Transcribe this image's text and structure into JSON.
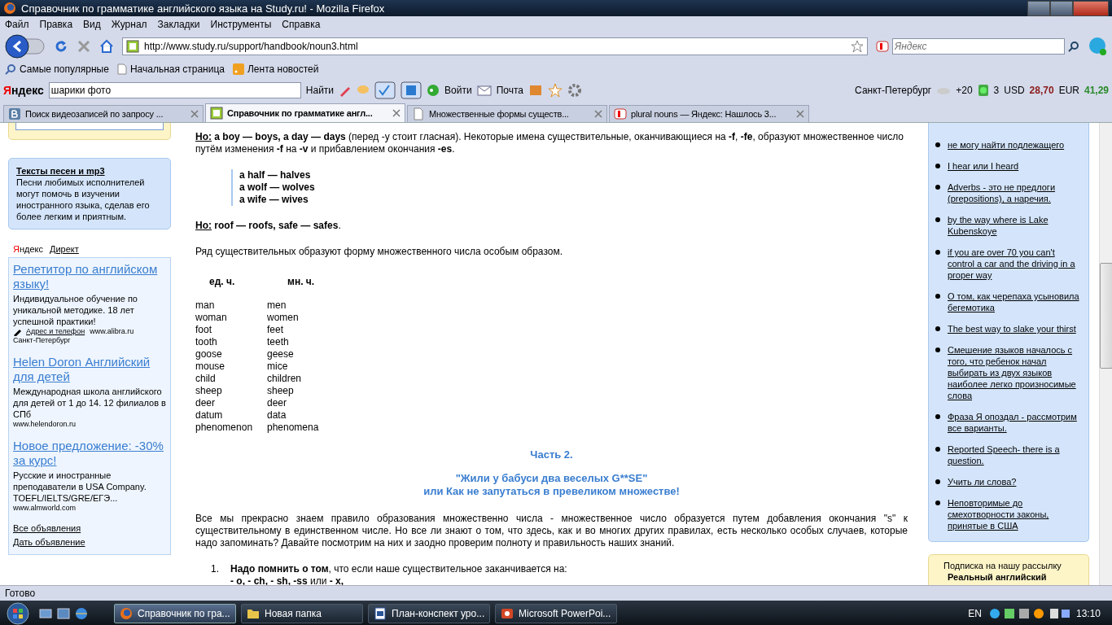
{
  "window": {
    "title": "Справочник по грамматике английского языка на Study.ru! - Mozilla Firefox"
  },
  "menu": [
    "Файл",
    "Правка",
    "Вид",
    "Журнал",
    "Закладки",
    "Инструменты",
    "Справка"
  ],
  "nav": {
    "url": "http://www.study.ru/support/handbook/noun3.html",
    "search_placeholder": "Яндекс"
  },
  "bookmarks": [
    "Самые популярные",
    "Начальная страница",
    "Лента новостей"
  ],
  "yandex_bar": {
    "logo": "Яндекс",
    "query": "шарики фото",
    "find": "Найти",
    "login": "Войти",
    "mail": "Почта",
    "city": "Санкт-Петербург",
    "temp": "+20",
    "traffic": "3",
    "usd_label": "USD",
    "usd": "28,70",
    "eur_label": "EUR",
    "eur": "41,29"
  },
  "tabs": [
    {
      "label": "Поиск видеозаписей по запросу ...",
      "selected": false,
      "kind": "vk"
    },
    {
      "label": "Справочник по грамматике англ...",
      "selected": true,
      "kind": "study"
    },
    {
      "label": "Множественные формы существ...",
      "selected": false,
      "kind": "page"
    },
    {
      "label": "plural nouns — Яндекс: Нашлось 3...",
      "selected": false,
      "kind": "yandex"
    }
  ],
  "left": {
    "promo": {
      "title": "Тексты песен и mp3",
      "text": "Песни любимых исполнителей могут помочь в изучении иностранного языка, сделав его более легким и приятным."
    },
    "direct": [
      "Яндекс",
      "Директ"
    ],
    "ads": [
      {
        "title": "Репетитор по английском языку!",
        "text": "Индивидуальное обучение по уникальной методике. 18 лет успешной практики!",
        "contact": "Адрес и телефон",
        "site": "www.alibra.ru",
        "city": "Санкт-Петербург"
      },
      {
        "title": "Helen Doron Английский для детей",
        "text": "Международная школа английского для детей от 1 до 14. 12 филиалов в СПб",
        "site": "www.helendoron.ru"
      },
      {
        "title": "Новое предложение: -30% за курс!",
        "text": "Русские и иностранные преподаватели в USA Company. TOEFL/IELTS/GRE/ЕГЭ...",
        "site": "www.almworld.com"
      }
    ],
    "links": [
      "Все объявления",
      "Дать объявление"
    ]
  },
  "article": {
    "p1": {
      "lead": "Но:",
      "text": "**a boy — boys, a day — days** (перед -y стоит гласная). Некоторые имена существительные, оканчивающиеся на **-f**, **-fe**, образуют множественное число путём изменения **-f** на **-v** и прибавлением окончания **-es**."
    },
    "quote": [
      "a half — halves",
      "a wolf — wolves",
      "a wife — wives"
    ],
    "p2": {
      "lead": "Но:",
      "text": "**roof — roofs, safe — safes**."
    },
    "p3": "Ряд существительных образуют форму множественного числа особым образом.",
    "table": {
      "columns": [
        "ед. ч.",
        "мн. ч."
      ],
      "rows": [
        [
          "man",
          "men"
        ],
        [
          "woman",
          "women"
        ],
        [
          "foot",
          "feet"
        ],
        [
          "tooth",
          "teeth"
        ],
        [
          "goose",
          "geese"
        ],
        [
          "mouse",
          "mice"
        ],
        [
          "child",
          "children"
        ],
        [
          "sheep",
          "sheep"
        ],
        [
          "deer",
          "deer"
        ],
        [
          "datum",
          "data"
        ],
        [
          "phenomenon",
          "phenomena"
        ]
      ]
    },
    "part": "Часть 2.",
    "title": [
      "\"Жили у бабуси два веселых G**SE\"",
      "или Как не запутаться в превеликом множестве!"
    ],
    "p4": "Все мы прекрасно знаем правило образования множественно числа - множественное число образуется путем добавления окончания \"s\" к существительному в единственном числе. Но все ли знают о том, что здесь, как и во многих других правилах, есть несколько особых случаев, которые надо запоминать? Давайте посмотрим на них и заодно проверим полноту и правильность наших знаний.",
    "list": [
      {
        "number": "1.",
        "text": "**Надо помнить о том**, что если наше существительное заканчивается на:",
        "sub": "**- o, - ch, - sh, -ss** или **- x,**"
      }
    ]
  },
  "right": {
    "links": [
      "не могу найти подлежащего",
      "I hear или I heard",
      "Adverbs - это не предлоги (prepositions), а наречия.",
      "by the way where is Lake Kubenskoye",
      "if you are over 70 you can't control a car and the driving in a proper way",
      "О том, как черепаха усыновила бегемотика",
      "The best way to slake your thirst",
      "Смешение языков началось с того, что ребенок начал выбирать из двух языков наиболее легко произносимые слова",
      "Фраза Я опоздал - рассмотрим все варианты.",
      "Reported Speech- there is a question.",
      "Учить ли слова?",
      "Неповторимые до смехотворности законы, принятые в США"
    ],
    "subscribe": [
      "Подписка на нашу рассылку",
      "Реальный английский"
    ]
  },
  "status_bar": "Готово",
  "taskbar": {
    "items": [
      {
        "label": "Справочник по гра...",
        "selected": true,
        "kind": "firefox"
      },
      {
        "label": "Новая папка",
        "selected": false,
        "kind": "folder"
      },
      {
        "label": "План-конспект уро...",
        "selected": false,
        "kind": "word"
      },
      {
        "label": "Microsoft PowerPoi...",
        "selected": false,
        "kind": "powerpoint"
      }
    ],
    "lang": "EN",
    "clock": "13:10"
  }
}
